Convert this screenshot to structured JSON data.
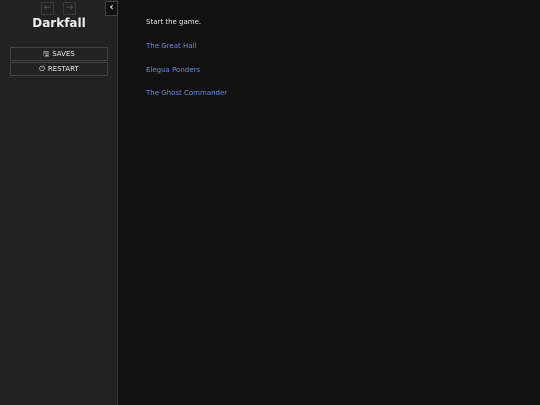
{
  "ui_bar": {
    "history_back_icon": "arrow-left-icon",
    "history_forward_icon": "arrow-right-icon",
    "toggle_icon": "chevron-left-icon",
    "history_back_glyph": "←",
    "history_forward_glyph": "→",
    "toggle_glyph": "‹",
    "story_title": "Darkfall",
    "menu": [
      {
        "label": "SAVES",
        "icon": "floppy-disk-icon",
        "glyph": "🖫"
      },
      {
        "label": "RESTART",
        "icon": "power-icon",
        "glyph": "⏻"
      }
    ]
  },
  "passage": {
    "text": "Start the game.",
    "links": [
      "The Great Hall",
      "Elegua Ponders",
      "The Ghost Commander"
    ]
  },
  "colors": {
    "background": "#111111",
    "sidebar": "#222222",
    "text": "#eeeeee",
    "link": "#6b8ddb"
  }
}
